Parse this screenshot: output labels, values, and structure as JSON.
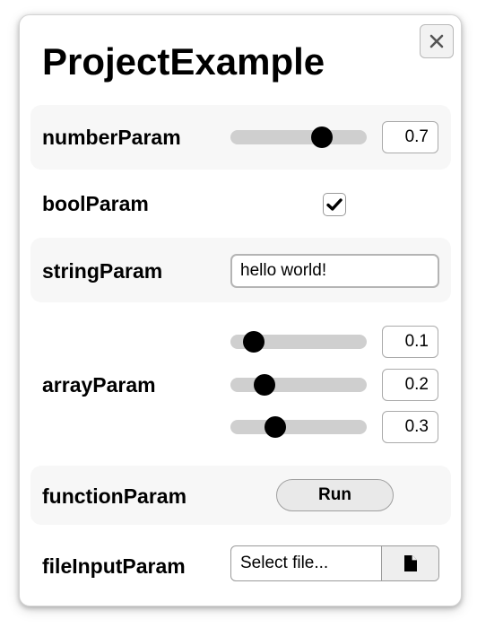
{
  "panel": {
    "title": "ProjectExample",
    "close_icon": "close-x-icon"
  },
  "params": {
    "number": {
      "label": "numberParam",
      "value": "0.7",
      "slider_fraction": 0.67
    },
    "bool": {
      "label": "boolParam",
      "checked": true,
      "check_icon": "checkmark-icon"
    },
    "string": {
      "label": "stringParam",
      "value": "hello world!"
    },
    "array": {
      "label": "arrayParam",
      "items": [
        {
          "value": "0.1",
          "slider_fraction": 0.17
        },
        {
          "value": "0.2",
          "slider_fraction": 0.25
        },
        {
          "value": "0.3",
          "slider_fraction": 0.33
        }
      ]
    },
    "function": {
      "label": "functionParam",
      "button_label": "Run"
    },
    "file": {
      "label": "fileInputParam",
      "placeholder": "Select file...",
      "icon": "file-icon"
    }
  },
  "colors": {
    "row_shade": "#f7f7f7",
    "slider_track": "#cfcfcf",
    "slider_thumb": "#000000"
  }
}
